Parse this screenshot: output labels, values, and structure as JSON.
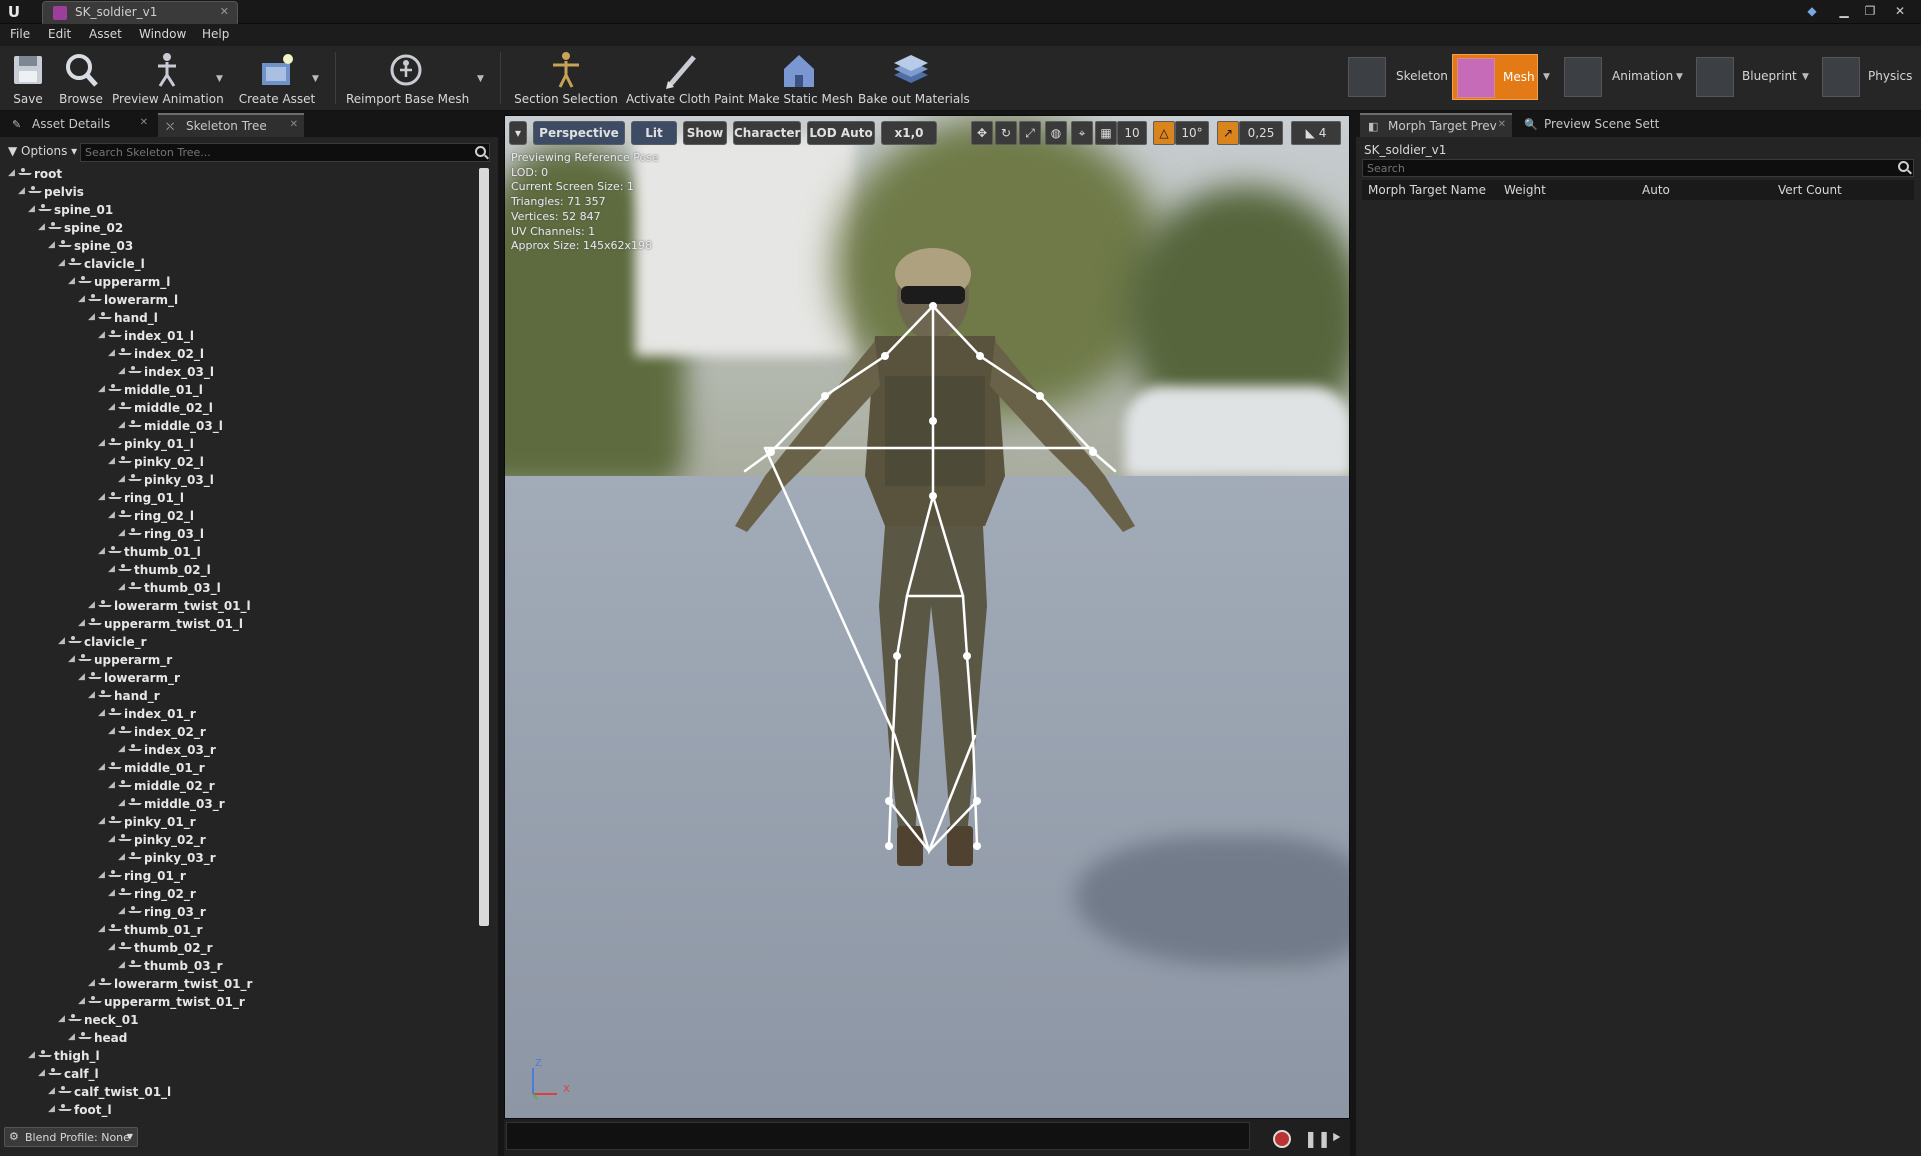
{
  "window": {
    "doc_tab": "SK_soldier_v1",
    "logo": "U"
  },
  "menu": [
    "File",
    "Edit",
    "Asset",
    "Window",
    "Help"
  ],
  "toolbar": {
    "buttons": [
      "Save",
      "Browse",
      "Preview Animation",
      "Create Asset",
      "Reimport Base Mesh",
      "Section Selection",
      "Activate Cloth Paint",
      "Make Static Mesh",
      "Bake out Materials"
    ],
    "modes": [
      "Skeleton",
      "Mesh",
      "Animation",
      "Blueprint",
      "Physics"
    ],
    "active_mode": "Mesh"
  },
  "left_panel": {
    "tabs": [
      "Asset Details",
      "Skeleton Tree"
    ],
    "options_label": "Options",
    "search_placeholder": "Search Skeleton Tree...",
    "bones": [
      [
        "root",
        0
      ],
      [
        "pelvis",
        1
      ],
      [
        "spine_01",
        2
      ],
      [
        "spine_02",
        3
      ],
      [
        "spine_03",
        4
      ],
      [
        "clavicle_l",
        5
      ],
      [
        "upperarm_l",
        6
      ],
      [
        "lowerarm_l",
        7
      ],
      [
        "hand_l",
        8
      ],
      [
        "index_01_l",
        9
      ],
      [
        "index_02_l",
        10
      ],
      [
        "index_03_l",
        11
      ],
      [
        "middle_01_l",
        9
      ],
      [
        "middle_02_l",
        10
      ],
      [
        "middle_03_l",
        11
      ],
      [
        "pinky_01_l",
        9
      ],
      [
        "pinky_02_l",
        10
      ],
      [
        "pinky_03_l",
        11
      ],
      [
        "ring_01_l",
        9
      ],
      [
        "ring_02_l",
        10
      ],
      [
        "ring_03_l",
        11
      ],
      [
        "thumb_01_l",
        9
      ],
      [
        "thumb_02_l",
        10
      ],
      [
        "thumb_03_l",
        11
      ],
      [
        "lowerarm_twist_01_l",
        8
      ],
      [
        "upperarm_twist_01_l",
        7
      ],
      [
        "clavicle_r",
        5
      ],
      [
        "upperarm_r",
        6
      ],
      [
        "lowerarm_r",
        7
      ],
      [
        "hand_r",
        8
      ],
      [
        "index_01_r",
        9
      ],
      [
        "index_02_r",
        10
      ],
      [
        "index_03_r",
        11
      ],
      [
        "middle_01_r",
        9
      ],
      [
        "middle_02_r",
        10
      ],
      [
        "middle_03_r",
        11
      ],
      [
        "pinky_01_r",
        9
      ],
      [
        "pinky_02_r",
        10
      ],
      [
        "pinky_03_r",
        11
      ],
      [
        "ring_01_r",
        9
      ],
      [
        "ring_02_r",
        10
      ],
      [
        "ring_03_r",
        11
      ],
      [
        "thumb_01_r",
        9
      ],
      [
        "thumb_02_r",
        10
      ],
      [
        "thumb_03_r",
        11
      ],
      [
        "lowerarm_twist_01_r",
        8
      ],
      [
        "upperarm_twist_01_r",
        7
      ],
      [
        "neck_01",
        5
      ],
      [
        "head",
        6
      ],
      [
        "thigh_l",
        2
      ],
      [
        "calf_l",
        3
      ],
      [
        "calf_twist_01_l",
        4
      ],
      [
        "foot_l",
        4
      ]
    ],
    "blend_profile": "Blend Profile: None"
  },
  "viewport": {
    "perspective": "Perspective",
    "lit": "Lit",
    "show": "Show",
    "character": "Character",
    "lod": "LOD Auto",
    "speed": "x1,0",
    "grid_snap": "10",
    "rot_snap": "10°",
    "scale_snap": "0,25",
    "cam_speed": "4",
    "info": [
      "Previewing Reference Pose",
      "LOD: 0",
      "Current Screen Size: 1",
      "Triangles: 71 357",
      "Vertices: 52 847",
      "UV Channels: 1",
      "Approx Size: 145x62x198"
    ],
    "axis": {
      "z": "Z",
      "x": "X"
    }
  },
  "right_panel": {
    "tabs": [
      "Morph Target Prev",
      "Preview Scene Sett"
    ],
    "title": "SK_soldier_v1",
    "search_placeholder": "Search",
    "columns": [
      "Morph Target Name",
      "Weight",
      "Auto",
      "Vert Count"
    ]
  }
}
